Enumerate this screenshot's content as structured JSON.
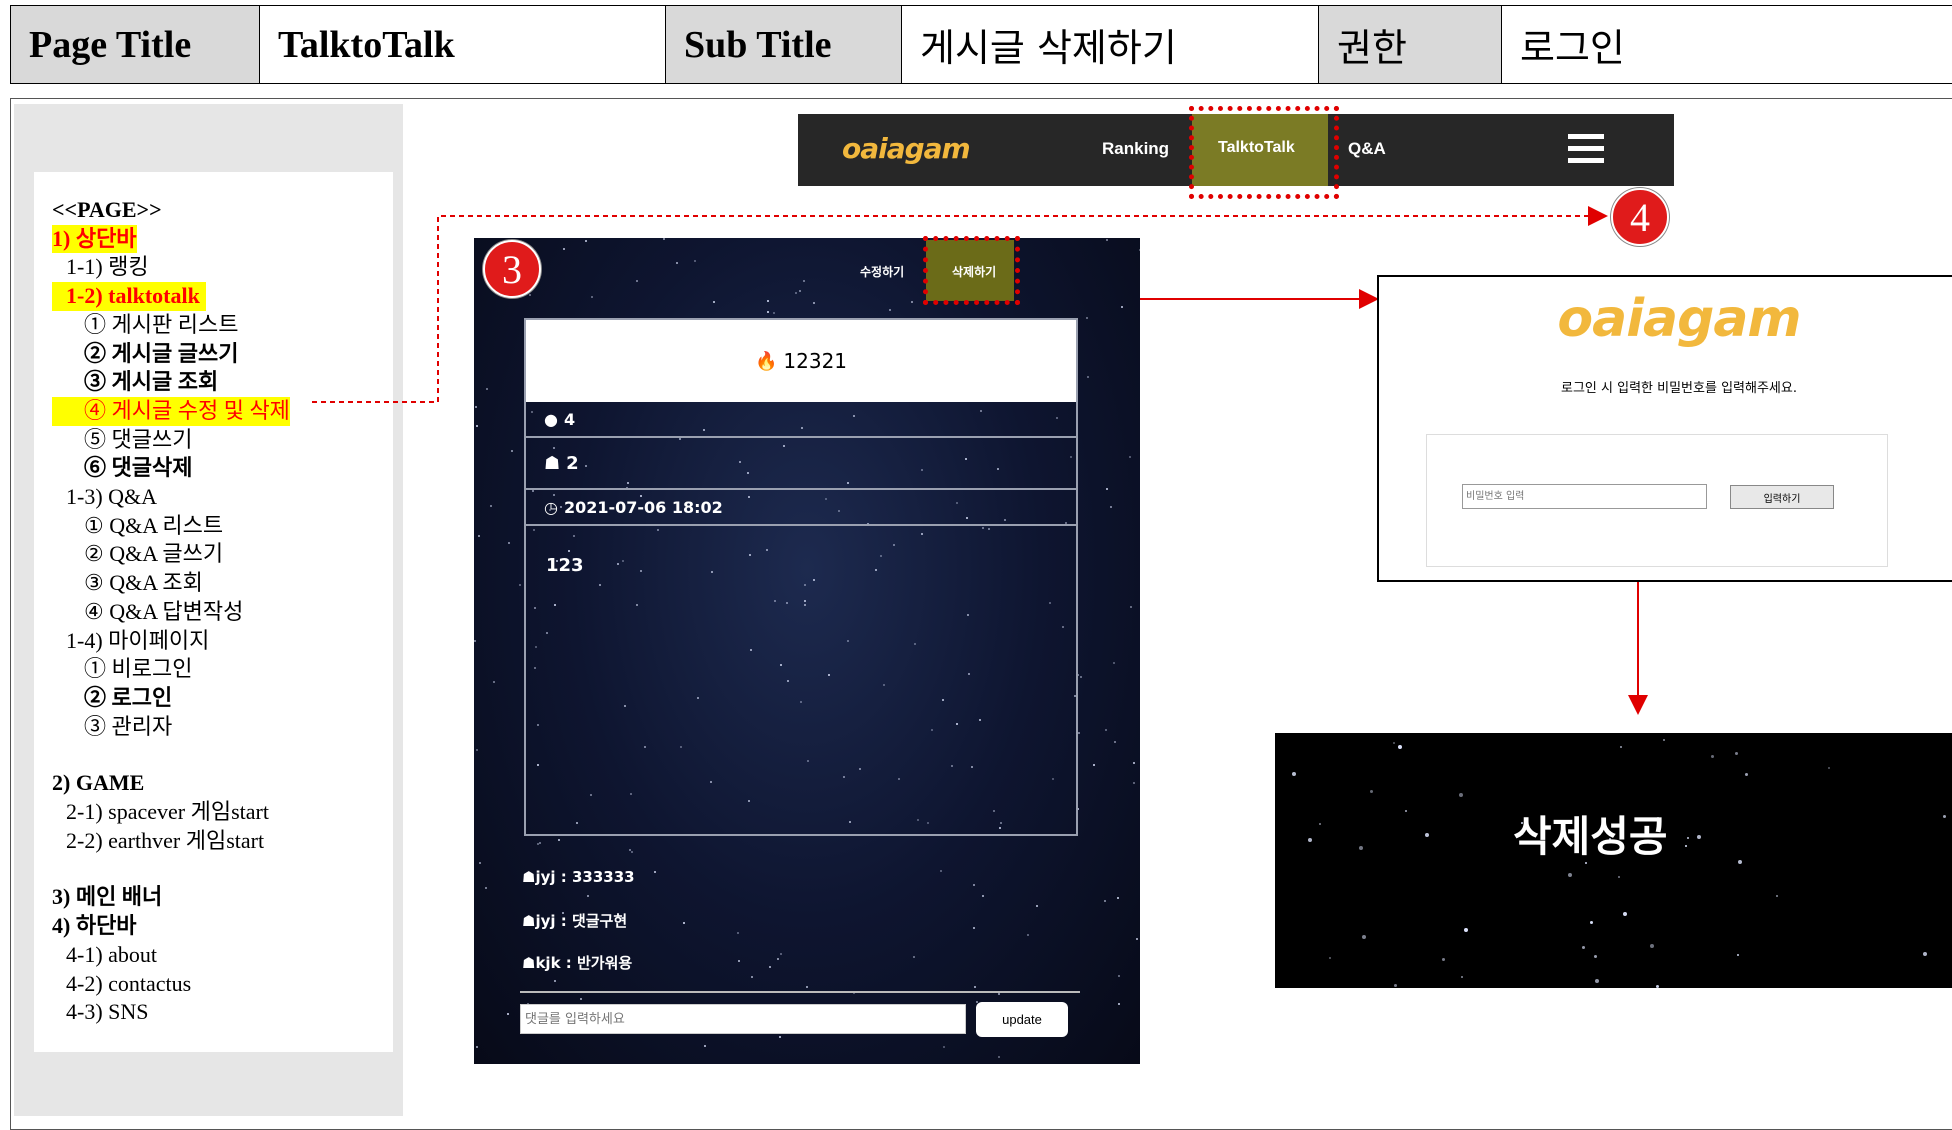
{
  "header": {
    "page_title_label": "Page Title",
    "page_title_value": "TalktoTalk",
    "sub_title_label": "Sub Title",
    "sub_title_value": "게시글 삭제하기",
    "auth_label": "권한",
    "auth_value": "로그인"
  },
  "sidebar": {
    "items": [
      "<<PAGE>>",
      "1) 상단바",
      "1-1) 랭킹",
      "1-2) talktotalk",
      "① 게시판 리스트",
      "② 게시글 글쓰기",
      "③ 게시글 조회",
      "④ 게시글 수정 및 삭제",
      "⑤ 댓글쓰기",
      "⑥ 댓글삭제",
      "1-3) Q&A",
      "① Q&A 리스트",
      "② Q&A 글쓰기",
      "③ Q&A 조회",
      "④ Q&A 답변작성",
      "1-4) 마이페이지",
      "① 비로그인",
      "② 로그인",
      "③ 관리자",
      "2) GAME",
      "2-1) spacever 게임start",
      "2-2) earthver 게임start",
      "3) 메인 배너",
      "4) 하단바",
      "4-1) about",
      "4-2) contactus",
      "4-3) SNS"
    ]
  },
  "navbar": {
    "logo": "oaiagam",
    "links": [
      "Ranking",
      "TalktoTalk",
      "Q&A"
    ],
    "active": "TalktoTalk",
    "menu_icon": "hamburger-icon"
  },
  "post": {
    "edit_label": "수정하기",
    "delete_label": "삭제하기",
    "title": "12321",
    "comment_count": "4",
    "author": "2",
    "date": "2021-07-06 18:02",
    "body": "123",
    "comments": [
      "jyj : 333333",
      "jyj : 댓글구현",
      "kjk : 반가워용"
    ],
    "comment_placeholder": "댓글를 입력하세요",
    "update_label": "update"
  },
  "login_modal": {
    "logo": "oaiagam",
    "message": "로그인 시 입력한 비밀번호를 입력해주세요.",
    "password_placeholder": "비밀번호 입력",
    "submit_label": "입력하기"
  },
  "result": {
    "message": "삭제성공"
  },
  "badges": {
    "three": "3",
    "four": "4"
  },
  "colors": {
    "highlight": "#ffff00",
    "highlight_text": "#ff0000",
    "nav_active": "#7b7b25",
    "logo": "#f2b83d",
    "arrow": "#e00000"
  }
}
